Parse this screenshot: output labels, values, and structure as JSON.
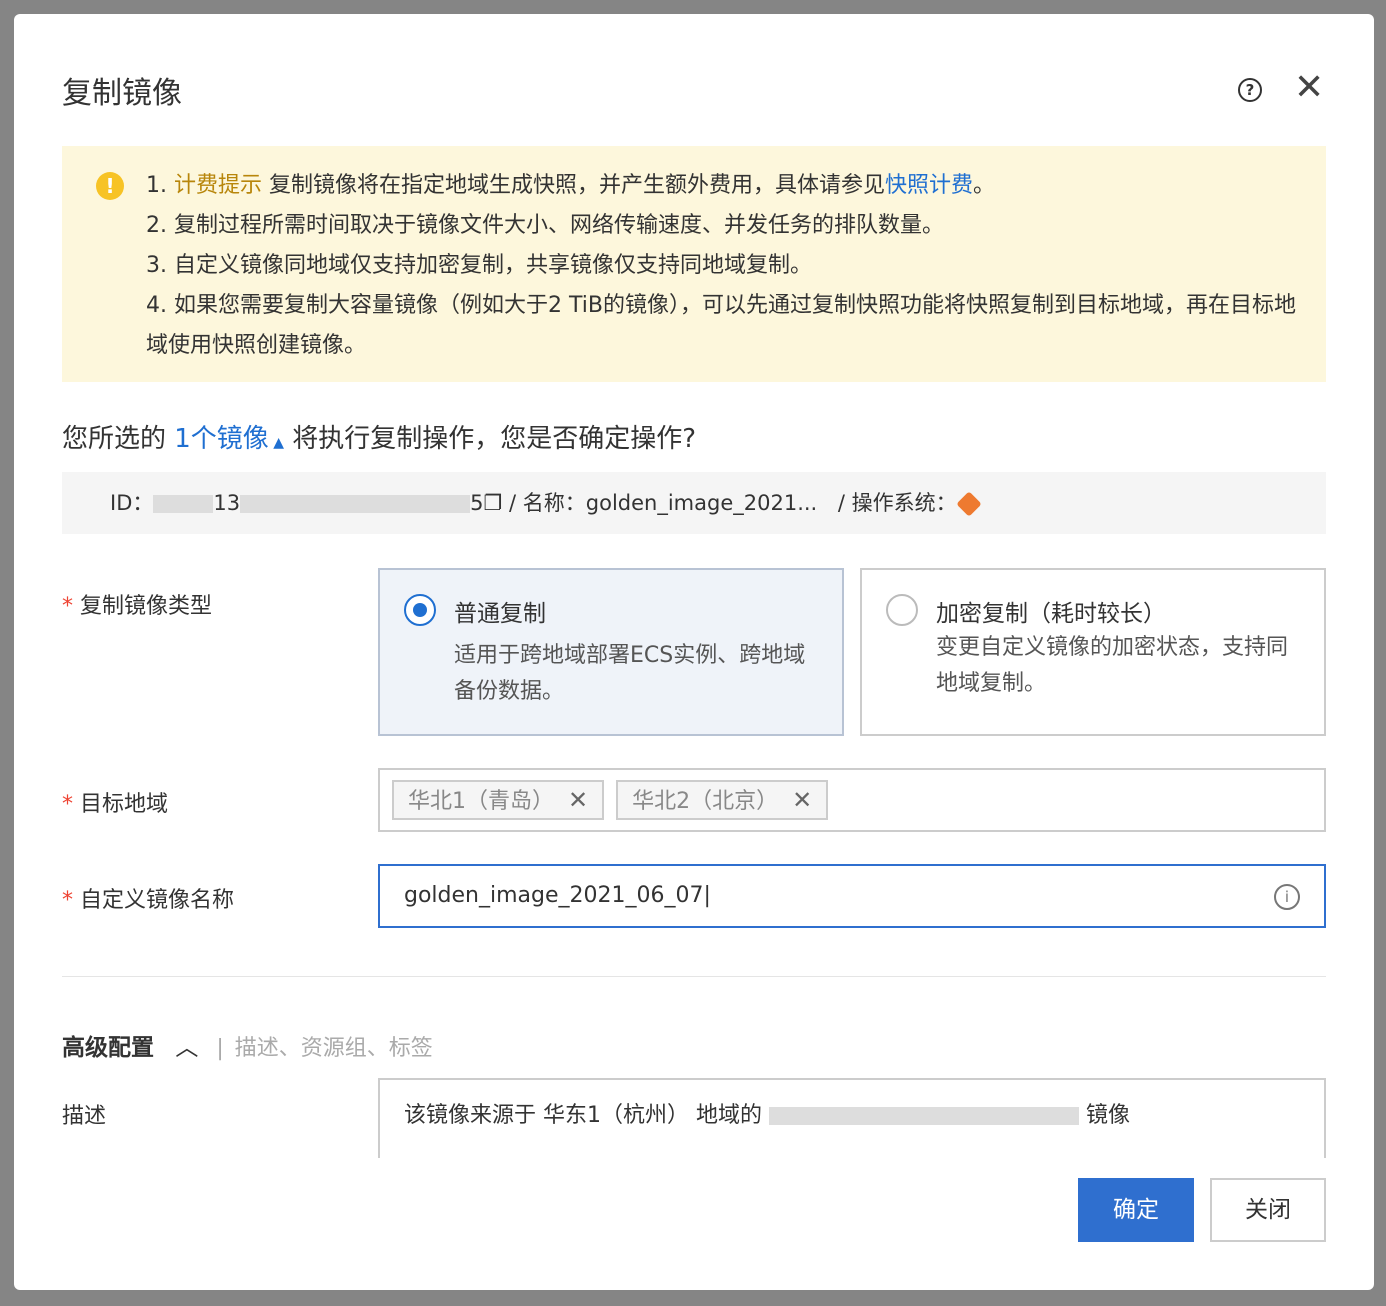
{
  "dialog": {
    "title": "复制镜像",
    "help_icon": "question-circle-icon",
    "close_icon": "close-icon"
  },
  "notice": {
    "line1_prefix": "1. ",
    "line1_highlight": "计费提示",
    "line1_text": " 复制镜像将在指定地域生成快照，并产生额外费用，具体请参见",
    "line1_link": "快照计费",
    "line1_end": "。",
    "line2": "2. 复制过程所需时间取决于镜像文件大小、网络传输速度、并发任务的排队数量。",
    "line3": "3. 自定义镜像同地域仅支持加密复制，共享镜像仅支持同地域复制。",
    "line4": "4. 如果您需要复制大容量镜像（例如大于2 TiB的镜像），可以先通过复制快照功能将快照复制到目标地域，再在目标地域使用快照创建镜像。"
  },
  "confirm": {
    "prefix": "您所选的 ",
    "count_link": "1个镜像",
    "suffix": " 将执行复制操作，您是否确定操作?"
  },
  "image_row": {
    "id_label": "ID：",
    "id_visible": "13",
    "id_end": "5",
    "name_label": "/ 名称：",
    "name": "golden_image_2021...",
    "os_label": "/ 操作系统："
  },
  "form": {
    "type_label": "复制镜像类型",
    "options": [
      {
        "title": "普通复制",
        "desc": "适用于跨地域部署ECS实例、跨地域备份数据。",
        "selected": true
      },
      {
        "title": "加密复制（耗时较长）",
        "desc": "变更自定义镜像的加密状态，支持同地域复制。",
        "selected": false
      }
    ],
    "region_label": "目标地域",
    "regions": [
      "华北1（青岛）",
      "华北2（北京）"
    ],
    "name_label": "自定义镜像名称",
    "name_value": "golden_image_2021_06_07"
  },
  "advanced": {
    "title": "高级配置",
    "sub": "描述、资源组、标签",
    "desc_label": "描述",
    "desc_prefix": "该镜像来源于 华东1（杭州） 地域的 ",
    "desc_suffix": " 镜像"
  },
  "buttons": {
    "ok": "确定",
    "cancel": "关闭"
  }
}
